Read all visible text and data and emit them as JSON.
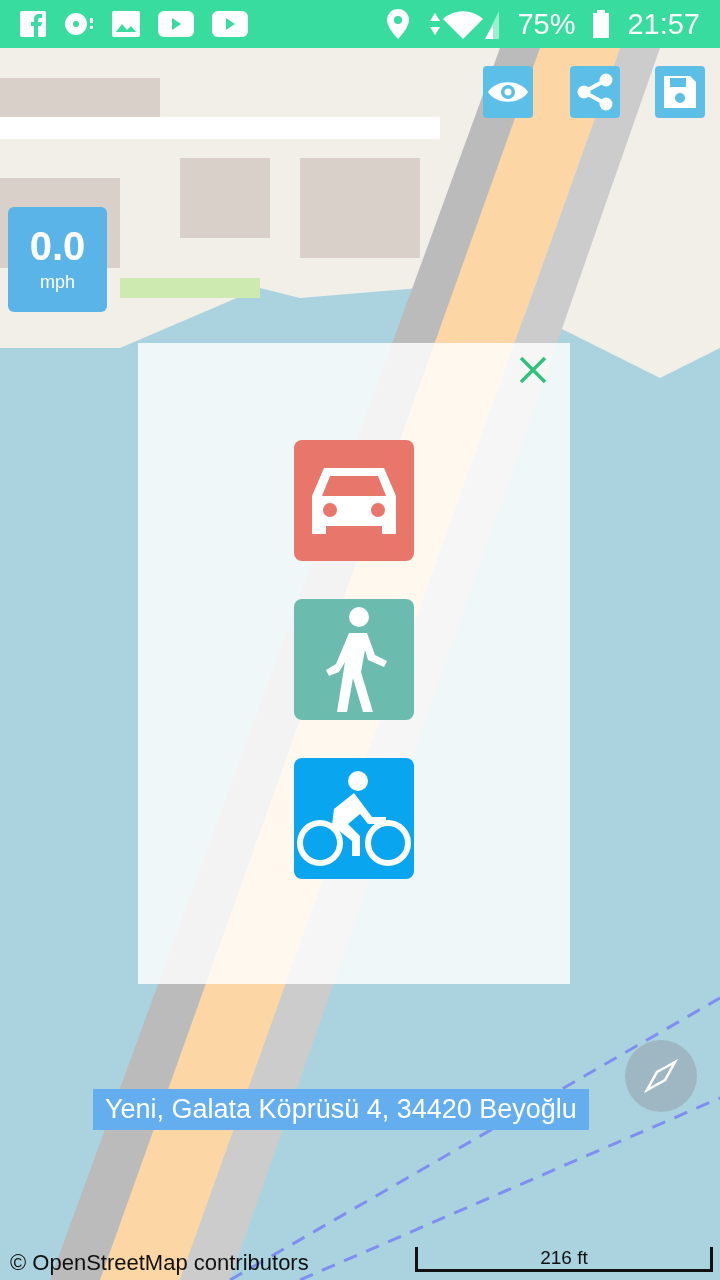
{
  "status_bar": {
    "battery": "75%",
    "time": "21:57"
  },
  "speedometer": {
    "value": "0.0",
    "unit": "mph"
  },
  "mode_dialog": {
    "modes": [
      {
        "kind": "car",
        "color": "#e8766b"
      },
      {
        "kind": "walk",
        "color": "#6bbcae"
      },
      {
        "kind": "bike",
        "color": "#0aa5ef"
      }
    ]
  },
  "address": "Yeni, Galata Köprüsü 4, 34420 Beyoğlu",
  "attribution": "© OpenStreetMap contributors",
  "scale": "216 ft"
}
